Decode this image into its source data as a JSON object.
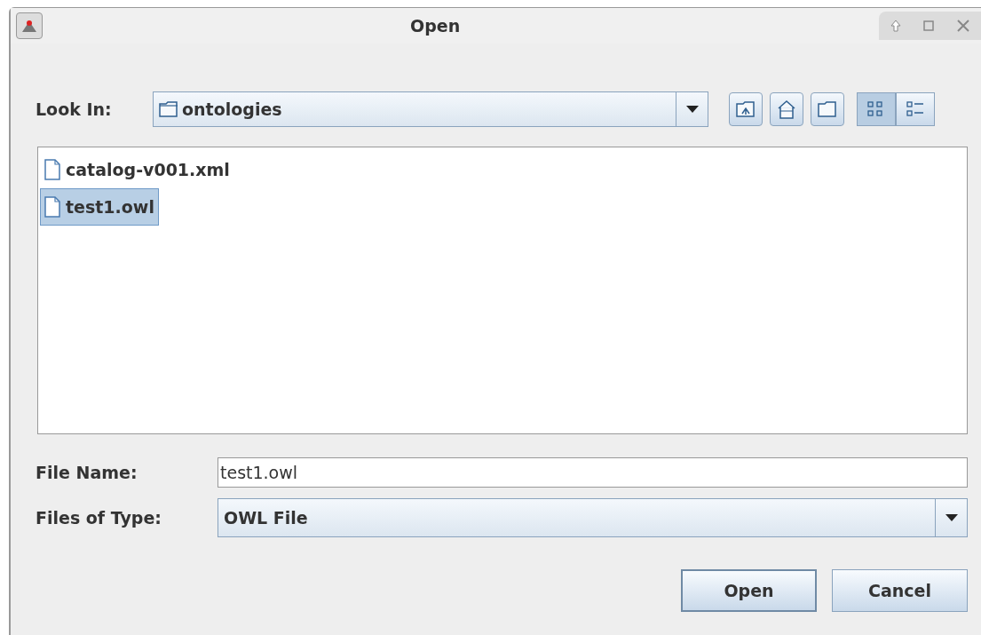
{
  "window": {
    "title": "Open"
  },
  "look_in": {
    "label": "Look In:",
    "value": "ontologies"
  },
  "toolbar": [
    {
      "kind": "up"
    },
    {
      "kind": "home"
    },
    {
      "kind": "new-folder"
    }
  ],
  "view_modes": [
    {
      "kind": "list",
      "selected": true
    },
    {
      "kind": "details",
      "selected": false
    }
  ],
  "files": [
    {
      "name": "catalog-v001.xml",
      "selected": false
    },
    {
      "name": "test1.owl",
      "selected": true
    }
  ],
  "file_name": {
    "label": "File Name:",
    "value": "test1.owl"
  },
  "file_type": {
    "label": "Files of Type:",
    "value": "OWL File"
  },
  "buttons": [
    {
      "label": "Open",
      "default": true
    },
    {
      "label": "Cancel",
      "default": false
    }
  ]
}
